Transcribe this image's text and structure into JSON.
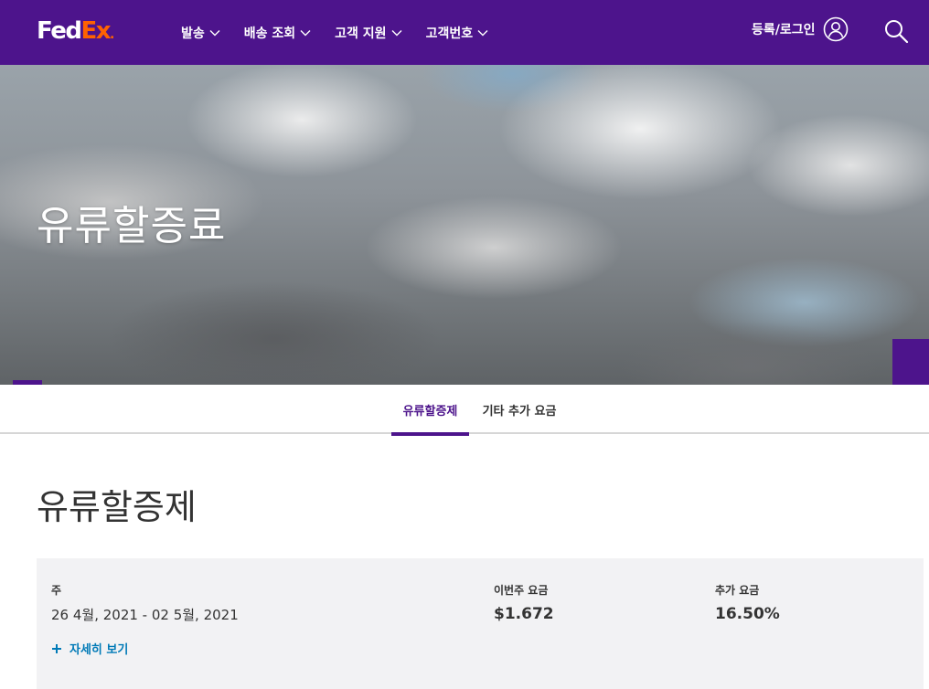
{
  "header": {
    "logo": {
      "fed": "Fed",
      "ex": "Ex",
      "dot": "."
    },
    "nav": [
      {
        "label": "발송"
      },
      {
        "label": "배송 조회"
      },
      {
        "label": "고객 지원"
      },
      {
        "label": "고객번호"
      }
    ],
    "login_label": "등록/로그인",
    "icons": {
      "user": "user-circle-icon",
      "search": "search-icon",
      "chevron": "chevron-down-icon"
    }
  },
  "hero": {
    "title": "유류할증료"
  },
  "tabs": [
    {
      "label": "유류할증제",
      "active": true
    },
    {
      "label": "기타 추가 요금",
      "active": false
    }
  ],
  "section": {
    "title": "유류할증제",
    "week_label": "주",
    "week_value": "26 4월, 2021 - 02 5월, 2021",
    "rate_label": "이번주 요금",
    "rate_value": "$1.672",
    "surcharge_label": "추가 요금",
    "surcharge_value": "16.50%",
    "more_label": "자세히 보기"
  },
  "colors": {
    "brand_purple": "#4d148c",
    "brand_orange": "#ff6200",
    "link_blue": "#007ab7",
    "card_bg": "#f2f2f4"
  }
}
